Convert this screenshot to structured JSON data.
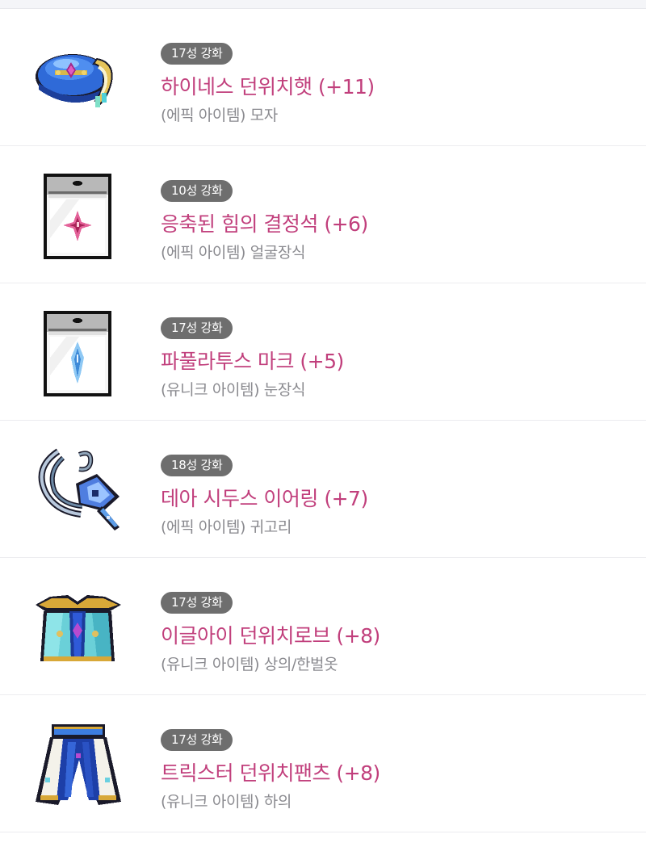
{
  "items": [
    {
      "badge": "17성 강화",
      "name": "하이네스 던위치햇 (+11)",
      "type": "(에픽 아이템) 모자",
      "icon": "blue-wizard-hat-icon"
    },
    {
      "badge": "10성 강화",
      "name": "응축된 힘의 결정석 (+6)",
      "type": "(에픽 아이템) 얼굴장식",
      "icon": "pink-crystal-card-icon"
    },
    {
      "badge": "17성 강화",
      "name": "파풀라투스 마크 (+5)",
      "type": "(유니크 아이템) 눈장식",
      "icon": "blue-crystal-card-icon"
    },
    {
      "badge": "18성 강화",
      "name": "데아 시두스 이어링 (+7)",
      "type": "(에픽 아이템) 귀고리",
      "icon": "earring-icon"
    },
    {
      "badge": "17성 강화",
      "name": "이글아이 던위치로브 (+8)",
      "type": "(유니크 아이템) 상의/한벌옷",
      "icon": "blue-robe-icon"
    },
    {
      "badge": "17성 강화",
      "name": "트릭스터 던위치팬츠 (+8)",
      "type": "(유니크 아이템) 하의",
      "icon": "blue-pants-icon"
    }
  ],
  "colors": {
    "item_name": "#c13f7c",
    "badge_bg": "#6e6e6e",
    "item_type": "#8a8a8f"
  }
}
